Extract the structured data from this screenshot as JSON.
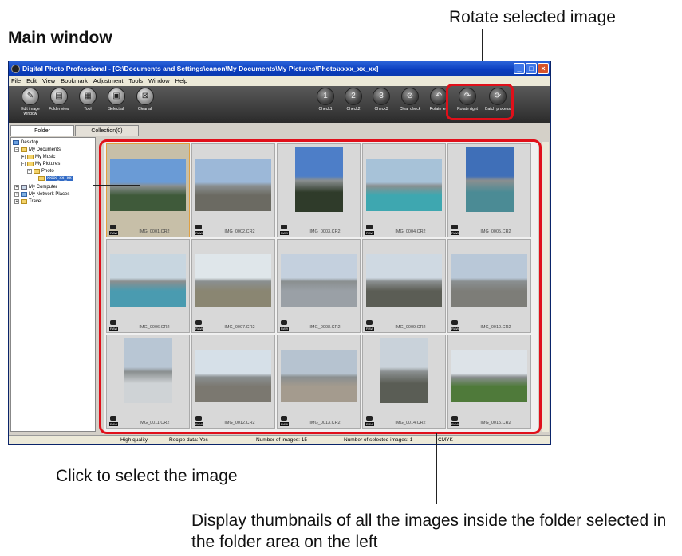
{
  "heading": "Main window",
  "annotations": {
    "rotate": "Rotate selected image",
    "click": "Click to select the image",
    "display": "Display thumbnails of all the images inside the folder selected in the folder area on the left"
  },
  "window": {
    "title": "Digital Photo Professional - [C:\\Documents and Settings\\canon\\My Documents\\My Pictures\\Photo\\xxxx_xx_xx]",
    "buttons": [
      "_",
      "□",
      "×"
    ]
  },
  "menu": [
    "File",
    "Edit",
    "View",
    "Bookmark",
    "Adjustment",
    "Tools",
    "Window",
    "Help"
  ],
  "toolbar": {
    "left": [
      {
        "label": "Edit image window",
        "icon": "edit-image-icon",
        "glyph": "✎"
      },
      {
        "label": "Folder view",
        "icon": "folder-view-icon",
        "glyph": "▤"
      },
      {
        "label": "Tool",
        "icon": "tool-icon",
        "glyph": "▦"
      },
      {
        "label": "Select all",
        "icon": "select-all-icon",
        "glyph": "▣"
      },
      {
        "label": "Clear all",
        "icon": "clear-all-icon",
        "glyph": "⊠"
      }
    ],
    "right": [
      {
        "label": "Check1",
        "icon": "check1-icon",
        "glyph": "1"
      },
      {
        "label": "Check2",
        "icon": "check2-icon",
        "glyph": "2"
      },
      {
        "label": "Check3",
        "icon": "check3-icon",
        "glyph": "3"
      },
      {
        "label": "Clear check",
        "icon": "clear-check-icon",
        "glyph": "⊘"
      },
      {
        "label": "Rotate left",
        "icon": "rotate-left-icon",
        "glyph": "↶"
      },
      {
        "label": "Rotate right",
        "icon": "rotate-right-icon",
        "glyph": "↷"
      },
      {
        "label": "Batch process",
        "icon": "batch-process-icon",
        "glyph": "⟳"
      }
    ]
  },
  "tabs": {
    "folder": "Folder",
    "collection": "Collection(0)"
  },
  "tree": {
    "desktop": "Desktop",
    "my_documents": "My Documents",
    "my_music": "My Music",
    "my_pictures": "My Pictures",
    "photo": "Photo",
    "selected": "xxxx_xx_xx",
    "my_computer": "My Computer",
    "my_network": "My Network Places",
    "travel": "Travel"
  },
  "thumbnails": [
    {
      "name": "IMG_0001.CR2",
      "sky": "#6a9bd6",
      "land": "#3f5a3a",
      "orient": "h"
    },
    {
      "name": "IMG_0002.CR2",
      "sky": "#9cb8d8",
      "land": "#6b6a62",
      "orient": "h"
    },
    {
      "name": "IMG_0003.CR2",
      "sky": "#4d7ec8",
      "land": "#2f3b2a",
      "orient": "v"
    },
    {
      "name": "IMG_0004.CR2",
      "sky": "#a7c2d8",
      "land": "#3ea7b0",
      "orient": "h"
    },
    {
      "name": "IMG_0005.CR2",
      "sky": "#3f6fb8",
      "land": "#4b8b95",
      "orient": "v"
    },
    {
      "name": "IMG_0006.CR2",
      "sky": "#c8d6e0",
      "land": "#4a9bb0",
      "orient": "h"
    },
    {
      "name": "IMG_0007.CR2",
      "sky": "#dfe6ea",
      "land": "#8a8672",
      "orient": "h"
    },
    {
      "name": "IMG_0008.CR2",
      "sky": "#c4d0de",
      "land": "#9aa0a6",
      "orient": "h"
    },
    {
      "name": "IMG_0009.CR2",
      "sky": "#cfd9e2",
      "land": "#5b5d55",
      "orient": "h"
    },
    {
      "name": "IMG_0010.CR2",
      "sky": "#b9c8d8",
      "land": "#7d7d78",
      "orient": "h"
    },
    {
      "name": "IMG_0011.CR2",
      "sky": "#b8c6d4",
      "land": "#cfd3d6",
      "orient": "v"
    },
    {
      "name": "IMG_0012.CR2",
      "sky": "#d6e0e8",
      "land": "#7b7870",
      "orient": "h"
    },
    {
      "name": "IMG_0013.CR2",
      "sky": "#b6c3d0",
      "land": "#a49b8e",
      "orient": "h"
    },
    {
      "name": "IMG_0014.CR2",
      "sky": "#c9d2da",
      "land": "#5a5d55",
      "orient": "v"
    },
    {
      "name": "IMG_0015.CR2",
      "sky": "#dde3e8",
      "land": "#4f7a3a",
      "orient": "h"
    }
  ],
  "status": {
    "quality": "High quality",
    "recipe": "Recipe data: Yes",
    "count": "Number of images: 15",
    "selected": "Number of selected images: 1",
    "color": "CMYK"
  },
  "colors": {
    "highlight": "#e0101a",
    "titlebar": "#0a3dbf"
  }
}
